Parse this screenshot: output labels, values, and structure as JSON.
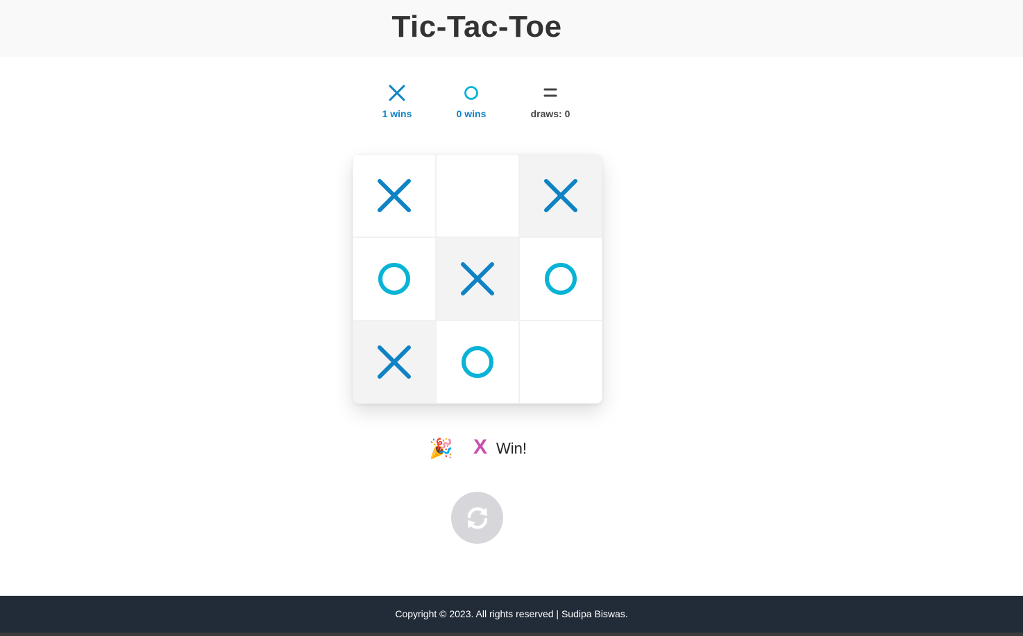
{
  "title": "Tic-Tac-Toe",
  "scoreboard": {
    "x": {
      "symbol_icon": "x-icon",
      "label": "1 wins",
      "wins": 1
    },
    "o": {
      "symbol_icon": "o-icon",
      "label": "0 wins",
      "wins": 0
    },
    "draws": {
      "symbol_icon": "equals-icon",
      "label": "draws: 0",
      "count": 0
    }
  },
  "board": {
    "cells": [
      "X",
      "",
      "X",
      "O",
      "X",
      "O",
      "X",
      "O",
      ""
    ],
    "winning_cells": [
      2,
      4,
      6
    ]
  },
  "result": {
    "emoji": "🎉",
    "winner": "X",
    "text": "Win!"
  },
  "restart": {
    "icon": "refresh-icon"
  },
  "footer": {
    "copyright": "Copyright © 2023. All rights reserved | Sudipa Biswas."
  },
  "colors": {
    "x_mark": "#0f83c4",
    "o_mark": "#08b3d6",
    "win_cell_bg": "#f3f3f4",
    "footer_bg": "#222b38",
    "winner_text": "#c84fb3"
  }
}
